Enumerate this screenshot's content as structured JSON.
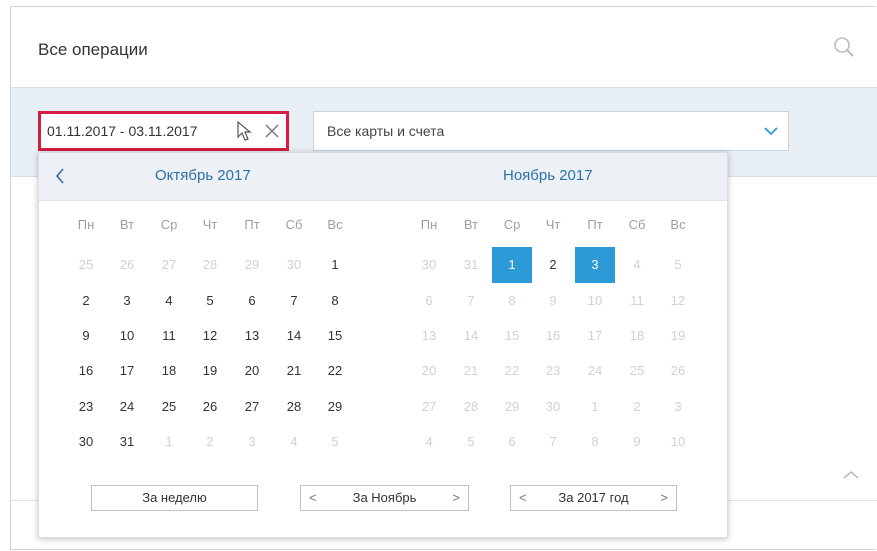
{
  "header": {
    "title": "Все операции"
  },
  "filters": {
    "date_range": "01.11.2017 - 03.11.2017",
    "accounts": "Все карты и счета"
  },
  "calendar": {
    "months": [
      "Октябрь 2017",
      "Ноябрь 2017"
    ],
    "weekdays": [
      "Пн",
      "Вт",
      "Ср",
      "Чт",
      "Пт",
      "Сб",
      "Вс"
    ],
    "october": [
      [
        "25",
        "26",
        "27",
        "28",
        "29",
        "30",
        "1"
      ],
      [
        "2",
        "3",
        "4",
        "5",
        "6",
        "7",
        "8"
      ],
      [
        "9",
        "10",
        "11",
        "12",
        "13",
        "14",
        "15"
      ],
      [
        "16",
        "17",
        "18",
        "19",
        "20",
        "21",
        "22"
      ],
      [
        "23",
        "24",
        "25",
        "26",
        "27",
        "28",
        "29"
      ],
      [
        "30",
        "31",
        "1",
        "2",
        "3",
        "4",
        "5"
      ]
    ],
    "october_muted": [
      [
        1,
        1,
        1,
        1,
        1,
        1,
        0
      ],
      [
        0,
        0,
        0,
        0,
        0,
        0,
        0
      ],
      [
        0,
        0,
        0,
        0,
        0,
        0,
        0
      ],
      [
        0,
        0,
        0,
        0,
        0,
        0,
        0
      ],
      [
        0,
        0,
        0,
        0,
        0,
        0,
        0
      ],
      [
        0,
        0,
        2,
        1,
        2,
        1,
        1
      ]
    ],
    "november": [
      [
        "30",
        "31",
        "1",
        "2",
        "3",
        "4",
        "5"
      ],
      [
        "6",
        "7",
        "8",
        "9",
        "10",
        "11",
        "12"
      ],
      [
        "13",
        "14",
        "15",
        "16",
        "17",
        "18",
        "19"
      ],
      [
        "20",
        "21",
        "22",
        "23",
        "24",
        "25",
        "26"
      ],
      [
        "27",
        "28",
        "29",
        "30",
        "1",
        "2",
        "3"
      ],
      [
        "4",
        "5",
        "6",
        "7",
        "8",
        "9",
        "10"
      ]
    ],
    "november_state": [
      [
        "m",
        "m",
        "sel",
        "range",
        "sel",
        "m",
        "m"
      ],
      [
        "m",
        "m",
        "m",
        "m",
        "m",
        "m",
        "m"
      ],
      [
        "m",
        "m",
        "m",
        "m",
        "m",
        "m",
        "m"
      ],
      [
        "m",
        "m",
        "m",
        "m",
        "m",
        "m",
        "m"
      ],
      [
        "m",
        "m",
        "m",
        "m",
        "m",
        "m",
        "m"
      ],
      [
        "m",
        "m",
        "m",
        "m",
        "m",
        "m",
        "m"
      ]
    ],
    "buttons": {
      "week": "За неделю",
      "month": "За Ноябрь",
      "year": "За 2017 год",
      "left_arrow": "<",
      "right_arrow": ">"
    }
  },
  "colors": {
    "accent": "#2b9ad6",
    "highlight_border": "#d51d43",
    "band": "#e8eff5"
  }
}
